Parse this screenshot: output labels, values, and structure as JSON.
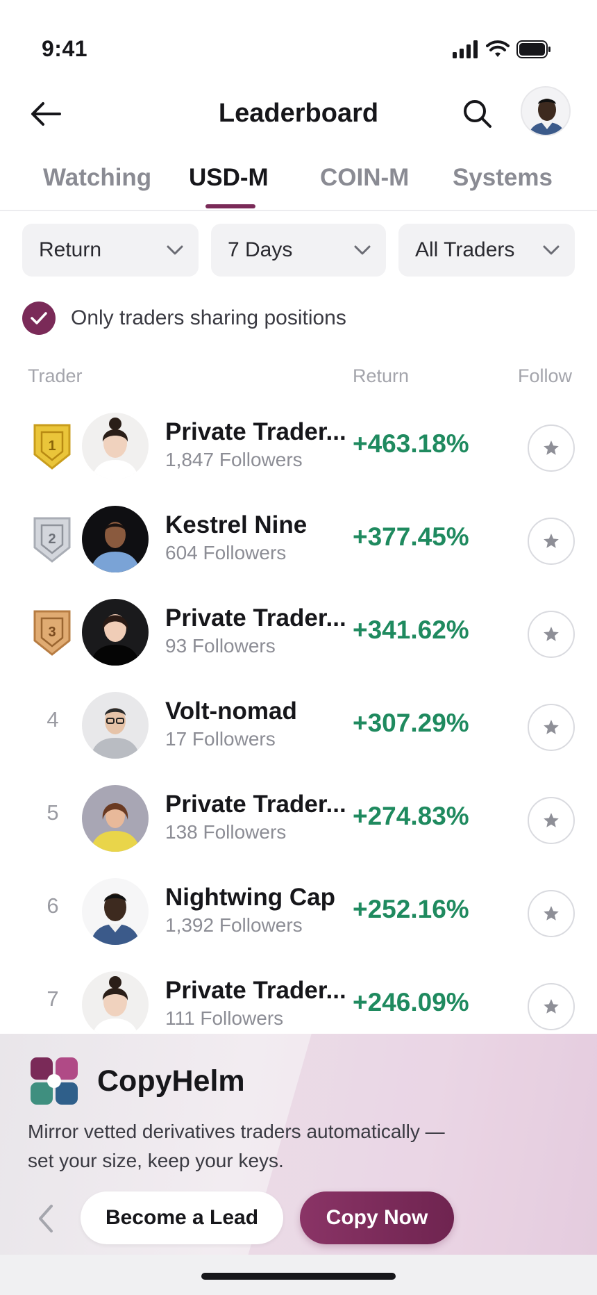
{
  "status_bar": {
    "time": "9:41"
  },
  "header": {
    "title": "Leaderboard"
  },
  "tabs": [
    {
      "label": "Watching"
    },
    {
      "label": "USD-M"
    },
    {
      "label": "COIN-M"
    },
    {
      "label": "Systems"
    }
  ],
  "active_tab": "USD-M",
  "filters": {
    "sort": "Return",
    "period": "7 Days",
    "traders": "All Traders"
  },
  "only_sharing": {
    "label": "Only traders sharing positions",
    "checked": true
  },
  "columns": {
    "trader": "Trader",
    "return": "Return",
    "follow": "Follow"
  },
  "traders": [
    {
      "rank": "1",
      "name": "Private Trader...",
      "followers": "1,847 Followers",
      "return": "+463.18%"
    },
    {
      "rank": "2",
      "name": "Kestrel Nine",
      "followers": "604 Followers",
      "return": "+377.45%"
    },
    {
      "rank": "3",
      "name": "Private Trader...",
      "followers": "93 Followers",
      "return": "+341.62%"
    },
    {
      "rank": "4",
      "name": "Volt-nomad",
      "followers": "17 Followers",
      "return": "+307.29%"
    },
    {
      "rank": "5",
      "name": "Private Trader...",
      "followers": "138 Followers",
      "return": "+274.83%"
    },
    {
      "rank": "6",
      "name": "Nightwing Cap",
      "followers": "1,392 Followers",
      "return": "+252.16%"
    },
    {
      "rank": "7",
      "name": "Private Trader...",
      "followers": "111 Followers",
      "return": "+246.09%"
    }
  ],
  "promo": {
    "brand": "CopyHelm",
    "description": "Mirror vetted derivatives traders automatically — set your size, keep your keys.",
    "lead_button": "Become a Lead",
    "copy_button": "Copy Now"
  },
  "colors": {
    "accent": "#7a2a58",
    "positive": "#1f8a5f",
    "gold": "#e8c33a",
    "silver": "#c9ccd2",
    "bronze": "#d9a56a"
  }
}
